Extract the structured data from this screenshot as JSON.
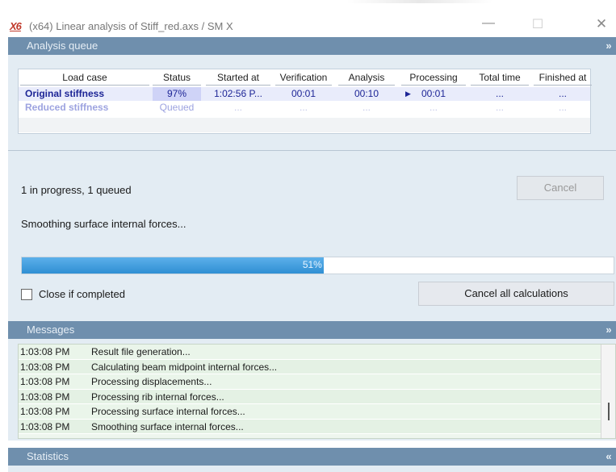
{
  "window": {
    "logo": "X6",
    "title": "(x64) Linear analysis of Stiff_red.axs / SM X",
    "controls": {
      "minimize": "—",
      "maximize": "☐",
      "close": "✕"
    }
  },
  "analysis_queue": {
    "header": "Analysis queue",
    "chevron": "»",
    "columns": [
      "Load case",
      "Status",
      "Started at",
      "Verification",
      "Analysis",
      "Processing",
      "Total time",
      "Finished at"
    ],
    "rows": [
      {
        "load_case": "Original stiffness",
        "status": "97%",
        "started_at": "1:02:56 P...",
        "verification": "00:01",
        "analysis": "00:10",
        "processing_marker": "▶",
        "processing": "00:01",
        "total_time": "...",
        "finished_at": "..."
      },
      {
        "load_case": "Reduced stiffness",
        "status": "Queued",
        "started_at": "...",
        "verification": "...",
        "analysis": "...",
        "processing": "...",
        "total_time": "...",
        "finished_at": "..."
      }
    ],
    "status_text": "1 in progress, 1 queued",
    "current_task": "Smoothing surface internal forces...",
    "cancel_button": "Cancel",
    "progress_percent": 51,
    "progress_label": "51%",
    "close_if_completed_label": "Close if completed",
    "close_if_completed_checked": false,
    "cancel_all_button": "Cancel all calculations"
  },
  "messages": {
    "header": "Messages",
    "chevron": "»",
    "items": [
      {
        "time": "1:03:08 PM",
        "text": "Result file generation..."
      },
      {
        "time": "1:03:08 PM",
        "text": "Calculating beam midpoint internal forces..."
      },
      {
        "time": "1:03:08 PM",
        "text": "Processing displacements..."
      },
      {
        "time": "1:03:08 PM",
        "text": "Processing rib internal forces..."
      },
      {
        "time": "1:03:08 PM",
        "text": "Processing surface internal forces..."
      },
      {
        "time": "1:03:08 PM",
        "text": "Smoothing surface internal forces..."
      }
    ]
  },
  "statistics": {
    "header": "Statistics",
    "chevron": "«"
  },
  "colors": {
    "section_header": "#6f8fad",
    "panel_bg": "#e3ecf3",
    "progress": "#3a9ae0",
    "active_row_text": "#1d2596",
    "queued_row_text": "#9da3e0"
  }
}
